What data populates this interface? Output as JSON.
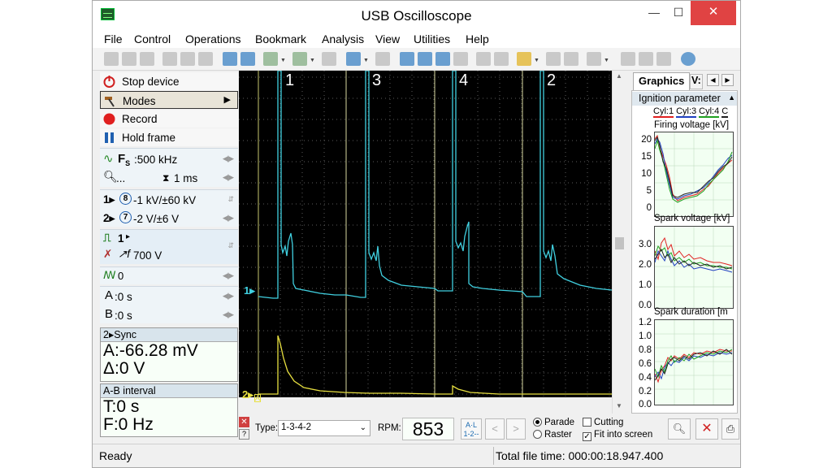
{
  "window": {
    "title": "USB Oscilloscope"
  },
  "menu": [
    "File",
    "Control",
    "Operations",
    "Bookmark",
    "Analysis",
    "View",
    "Utilities",
    "Help"
  ],
  "left_panel": {
    "stop_device": "Stop device",
    "modes": "Modes",
    "record": "Record",
    "hold_frame": "Hold frame",
    "sample_rate": ":500 kHz",
    "zoom": "...",
    "timebase": "1 ms",
    "ch1_range": "-1 kV/±60 kV",
    "ch2_range": "-2 V/±6 V",
    "trigger_source": "1",
    "trigger_level": "700 V",
    "filter_value": "0",
    "cursor_a": ":0 s",
    "cursor_b": ":0 s",
    "sync_header": "Sync",
    "sync_channel": "2",
    "sync_a": "A:-66.28 mV",
    "sync_delta": "Δ:0 V",
    "ab_header": "A-B interval",
    "ab_t": "T:0 s",
    "ab_f": "F:0 Hz"
  },
  "scope": {
    "cylinder_labels": [
      "1",
      "3",
      "4",
      "2"
    ],
    "ch1_marker": "1",
    "ch2_marker": "2",
    "ch1_color": "#40d0e0",
    "ch2_color": "#e8e040",
    "cursor_marker_a": "A",
    "cursor_marker_b": "B"
  },
  "right_panel": {
    "tab_graphics": "Graphics",
    "tab_second": "V:",
    "ignition_header": "Ignition parameter",
    "legend": [
      "Cyl:1",
      "Cyl:3",
      "Cyl:4",
      "C"
    ],
    "legend_colors": [
      "#e02020",
      "#2040c0",
      "#20a020",
      "#222222"
    ],
    "firing_title": "Firing voltage [kV]",
    "firing_ticks": [
      "20",
      "15",
      "10",
      "5",
      "0"
    ],
    "spark_v_title": "Spark voltage [kV]",
    "spark_v_ticks": [
      "3.0",
      "2.0",
      "1.0",
      "0.0"
    ],
    "spark_d_title": "Spark duration [m",
    "spark_d_ticks": [
      "1.2",
      "1.0",
      "0.8",
      "0.6",
      "0.4",
      "0.2",
      "0.0"
    ]
  },
  "bottom": {
    "type_label": "Type:",
    "type_value": "1-3-4-2",
    "rpm_label": "RPM:",
    "rpm_value": "853",
    "sync_button": "1-2--",
    "parade": "Parade",
    "raster": "Raster",
    "cutting": "Cutting",
    "fit_screen": "Fit into screen"
  },
  "status": {
    "left": "Ready",
    "right": "Total file time: 000:00:18.947.400"
  }
}
